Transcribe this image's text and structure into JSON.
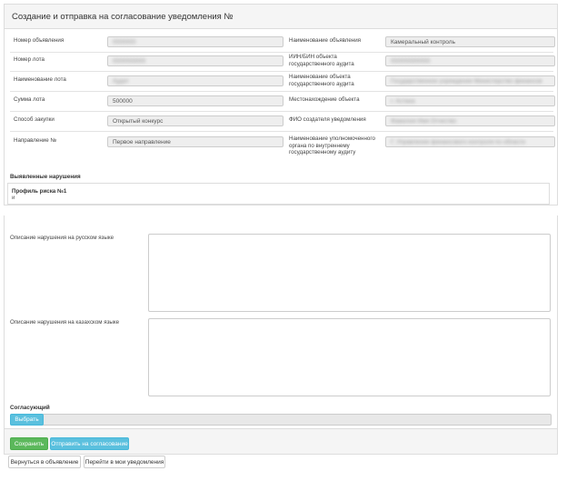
{
  "header": {
    "title": "Создание и отправка на согласование уведомления №"
  },
  "fields_left": [
    {
      "label": "Номер объявления",
      "value": ""
    },
    {
      "label": "Номер лота",
      "value": ""
    },
    {
      "label": "Наименование лота",
      "value": ""
    },
    {
      "label": "Сумма лота",
      "value": "500000"
    },
    {
      "label": "Способ закупки",
      "value": "Открытый конкурс"
    },
    {
      "label": "Направление №",
      "value": "Первое направление"
    }
  ],
  "fields_right": [
    {
      "label": "Наименование объявления",
      "value": "Камеральный контроль"
    },
    {
      "label": "ИИН/БИН объекта государственного аудита",
      "value": ""
    },
    {
      "label": "Наименование объекта государственного аудита",
      "value": ""
    },
    {
      "label": "Местонахождение объекта",
      "value": ""
    },
    {
      "label": "ФИО создателя уведомления",
      "value": ""
    },
    {
      "label": "Наименование уполномоченного органа по внутреннему государственному аудиту",
      "value": ""
    }
  ],
  "violations": {
    "title": "Выявленные нарушения",
    "risk_profile": "Профиль риска №1",
    "risk_note": "и"
  },
  "descriptions": {
    "ru_label": "Описание нарушения на русском языке",
    "kz_label": "Описание нарушения на казахском языке",
    "ru_value": "",
    "kz_value": ""
  },
  "approvers": {
    "label": "Согласующий",
    "select_button": "Выбрать"
  },
  "actions": {
    "save": "Сохранить",
    "send": "Отправить на согласование",
    "back": "Вернуться в объявление",
    "my_notifications": "Перейти в мои уведомления"
  }
}
